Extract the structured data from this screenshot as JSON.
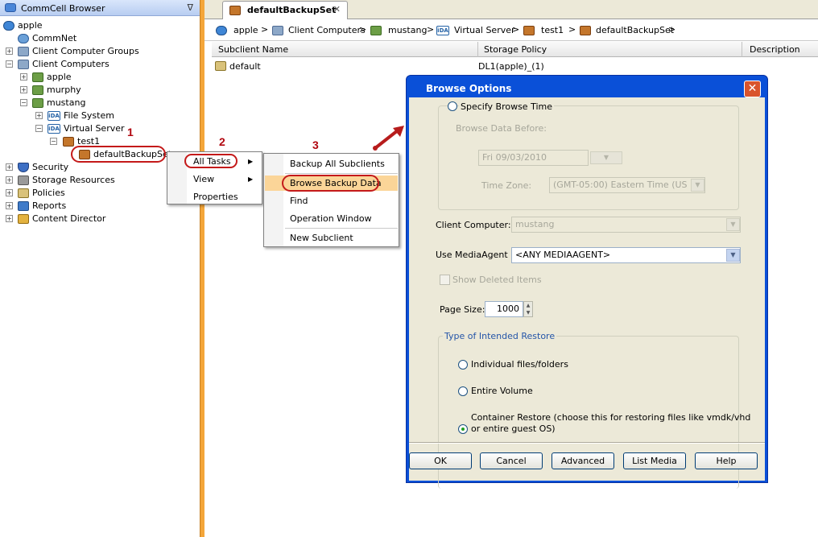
{
  "tree": {
    "title": "CommCell Browser",
    "pin": "ᐁ",
    "nodes": {
      "root": "apple",
      "commnet": "CommNet",
      "client_groups": "Client Computer Groups",
      "client_computers": "Client Computers",
      "apple": "apple",
      "murphy": "murphy",
      "mustang": "mustang",
      "file_system": "File System",
      "virtual_server": "Virtual Server",
      "test1": "test1",
      "backup_set": "defaultBackupSet",
      "security": "Security",
      "storage_resources": "Storage Resources",
      "policies": "Policies",
      "reports": "Reports",
      "content_director": "Content Director"
    },
    "ida_label": "iDA"
  },
  "annotations": {
    "step1": "1",
    "step2": "2",
    "step3": "3"
  },
  "tab": {
    "title": "defaultBackupSet",
    "close": "✕"
  },
  "breadcrumb": [
    "apple",
    "Client Computers",
    "mustang",
    "Virtual Server",
    "test1",
    "defaultBackupSet"
  ],
  "breadcrumb_sep": ">",
  "table": {
    "columns": [
      "Subclient Name",
      "Storage Policy",
      "Description"
    ],
    "rows": [
      {
        "name": "default",
        "policy": "DL1(apple)_(1)"
      }
    ]
  },
  "menu1": {
    "items": [
      "All Tasks",
      "View",
      "Properties"
    ]
  },
  "menu2": {
    "items": [
      "Backup All Subclients",
      "Browse Backup Data",
      "Find",
      "Operation Window",
      "New Subclient"
    ]
  },
  "dialog": {
    "title": "Browse Options",
    "close": "✕",
    "specify_browse_time": "Specify Browse Time",
    "browse_data_before": "Browse Data Before:",
    "date_value": "Fri 09/03/2010",
    "time_zone_label": "Time Zone:",
    "time_zone_value": "(GMT-05:00) Eastern Time (US ...",
    "client_computer_label": "Client Computer:",
    "client_computer_value": "mustang",
    "use_mediaagent_label": "Use MediaAgent",
    "use_mediaagent_value": "<ANY MEDIAAGENT>",
    "show_deleted": "Show Deleted Items",
    "page_size_label": "Page Size:",
    "page_size_value": "1000",
    "restore_group": "Type of Intended Restore",
    "opt_individual": "Individual files/folders",
    "opt_entire_volume": "Entire Volume",
    "opt_container_l1": "Container Restore (choose this for restoring files like vmdk/vhd",
    "opt_container_l2": "or entire guest OS)",
    "buttons": {
      "ok": "OK",
      "cancel": "Cancel",
      "advanced": "Advanced",
      "list_media": "List Media",
      "help": "Help"
    }
  },
  "colors": {
    "accent_red": "#c41a1a",
    "dialog_blue": "#0a50d8",
    "splitter": "#f4a63a"
  }
}
